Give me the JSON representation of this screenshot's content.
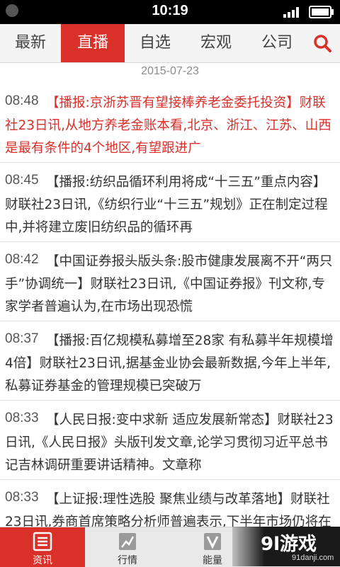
{
  "status_bar": {
    "time": "10:19"
  },
  "tabs": [
    {
      "label": "最新"
    },
    {
      "label": "直播",
      "active": true
    },
    {
      "label": "自选"
    },
    {
      "label": "宏观"
    },
    {
      "label": "公司"
    }
  ],
  "date": "2015-07-23",
  "news": [
    {
      "time": "08:48",
      "text": "【播报:京浙苏晋有望接棒养老金委托投资】财联社23日讯,从地方养老金账本看,北京、浙江、江苏、山西是最有条件的4个地区,有望跟进广",
      "highlight": true
    },
    {
      "time": "08:45",
      "text": "【播报:纺织品循环利用将成“十三五”重点内容】财联社23日讯,《纺织行业“十三五”规划》正在制定过程中,并将建立废旧纺织品的循环再"
    },
    {
      "time": "08:42",
      "text": "【中国证券报头版头条:股市健康发展离不开“两只手”协调统一】财联社23日讯,《中国证券报》刊文称,专家学者普遍认为,在市场出现恐慌"
    },
    {
      "time": "08:37",
      "text": "【播报:百亿规模私募增至28家 有私募半年规模增4倍】财联社23日讯,据基金业协会最新数据,今年上半年,私募证券基金的管理规模已突破万"
    },
    {
      "time": "08:33",
      "text": "【人民日报:变中求新 适应发展新常态】财联社23日讯,《人民日报》头版刊发文章,论学习贯彻习近平总书记吉林调研重要讲话精神。文章称"
    },
    {
      "time": "08:33",
      "text": "【上证报:理性选股 聚焦业绩与改革落地】财联社23日讯,券商首席策略分析师普遍表示,下半年市场仍将在休养生息后继续上行,而在经历加此"
    }
  ],
  "bottom_tabs": [
    {
      "label": "资讯",
      "icon": "news-icon",
      "active": true
    },
    {
      "label": "行情",
      "icon": "chart-icon"
    },
    {
      "label": "能量",
      "icon": "energy-icon"
    }
  ],
  "watermark": {
    "brand": "9l游戏",
    "site": "91danji.com"
  },
  "colors": {
    "accent": "#d9302a",
    "status_bar": "#000000",
    "text": "#333333",
    "muted": "#8b8b8b"
  }
}
